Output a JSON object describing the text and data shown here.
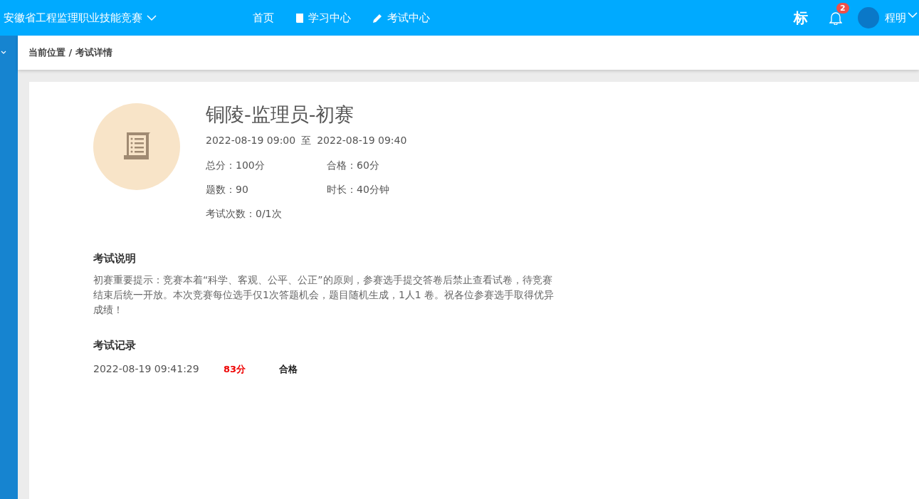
{
  "brand": {
    "title": "安徽省工程监理职业技能竞赛"
  },
  "nav": [
    {
      "label": "首页",
      "kind": "plain"
    },
    {
      "label": "学习中心",
      "kind": "book"
    },
    {
      "label": "考试中心",
      "kind": "pencil"
    }
  ],
  "header_right": {
    "mark": "标",
    "notification_count": "2",
    "user_name": "程明"
  },
  "breadcrumb": "当前位置 / 考试详情",
  "exam": {
    "title": "铜陵-监理员-初赛",
    "start": "2022-08-19 09:00",
    "to": "至",
    "end": "2022-08-19 09:40",
    "facts": [
      [
        "总分：100分",
        "合格：60分"
      ],
      [
        "题数：90",
        "时长：40分钟"
      ],
      [
        "考试次数：0/1次"
      ]
    ]
  },
  "description": {
    "heading": "考试说明",
    "text": "初赛重要提示：竞赛本着“科学、客观、公平、公正”的原则，参赛选手提交答卷后禁止查看试卷，待竞赛结束后统一开放。本次竞赛每位选手仅1次答题机会，题目随机生成，1人1 卷。祝各位参赛选手取得优异成绩！"
  },
  "records": {
    "heading": "考试记录",
    "rows": [
      {
        "time": "2022-08-19 09:41:29",
        "score": "83分",
        "result": "合格",
        "passed": true
      }
    ]
  }
}
